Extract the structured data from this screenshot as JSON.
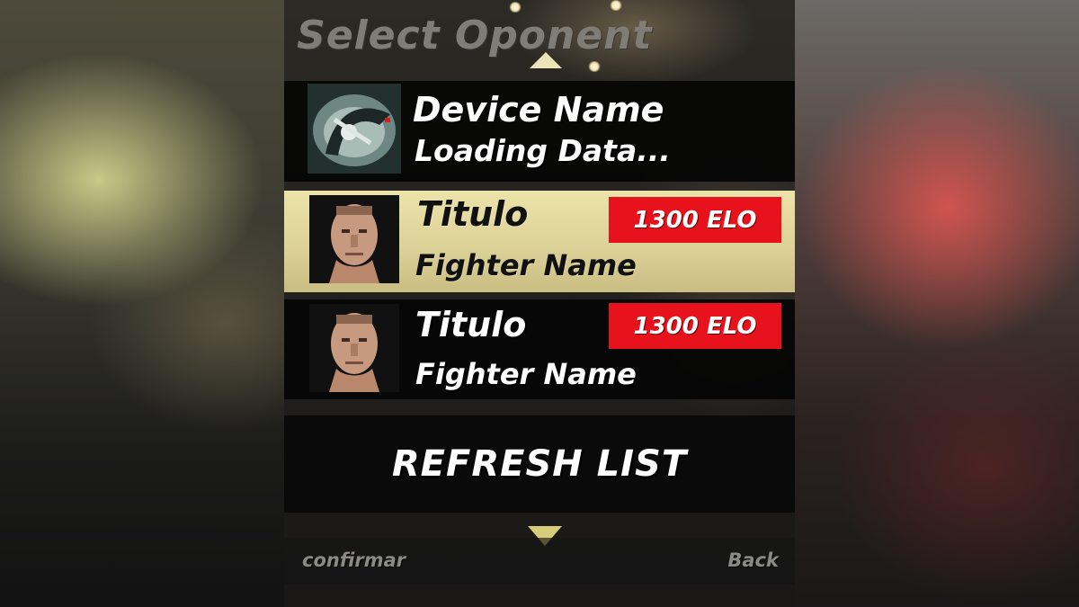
{
  "screen": {
    "title": "Select Oponent"
  },
  "device_entry": {
    "name": "Device Name",
    "status": "Loading Data..."
  },
  "opponents": [
    {
      "title": "Titulo",
      "fighter_name": "Fighter Name",
      "elo": "1300 ELO",
      "selected": true
    },
    {
      "title": "Titulo",
      "fighter_name": "Fighter Name",
      "elo": "1300 ELO",
      "selected": false
    }
  ],
  "refresh_button": {
    "label": "REFRESH LIST"
  },
  "softkeys": {
    "left": "confirmar",
    "right": "Back"
  },
  "colors": {
    "elo_badge": "#e8121d",
    "selected_row": "#ddd297",
    "arrow": "#d6cc7a"
  }
}
